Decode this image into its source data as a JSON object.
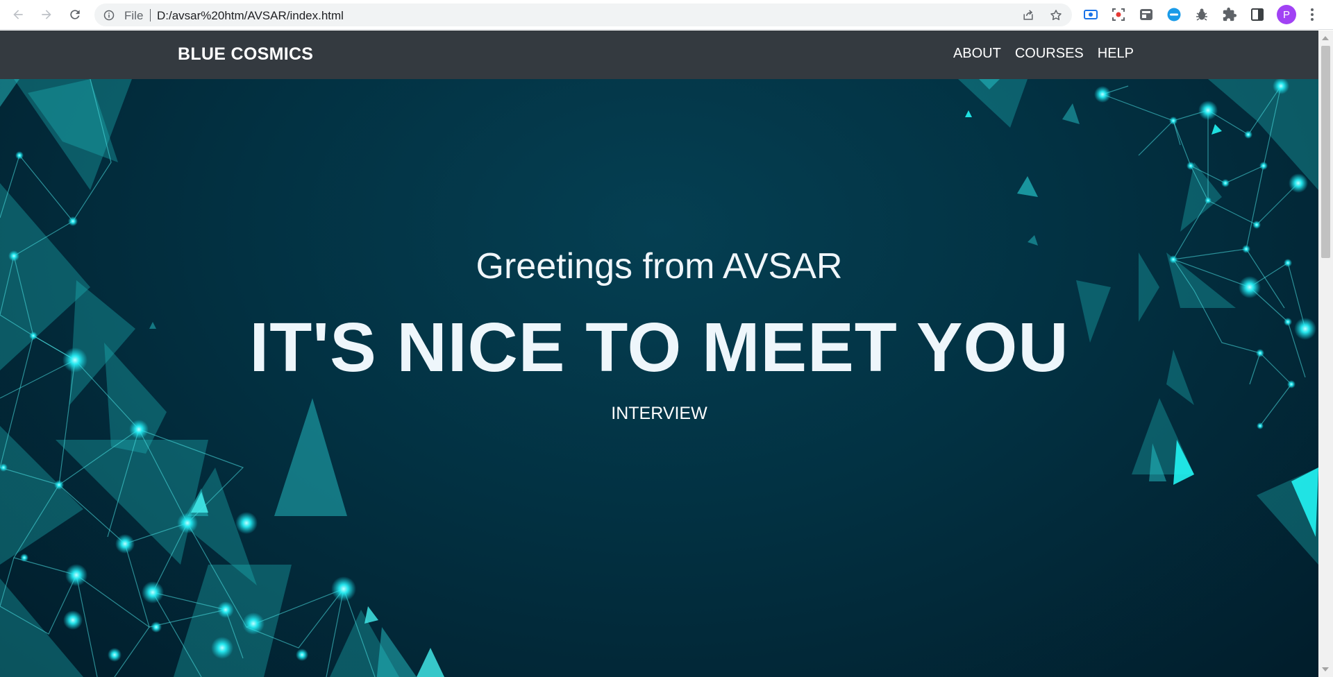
{
  "browser": {
    "scheme_label": "File",
    "url": "D:/avsar%20htm/AVSAR/index.html",
    "profile_initial": "P",
    "icons": [
      "back-icon",
      "forward-icon",
      "reload-icon",
      "info-icon",
      "share-icon",
      "bookmark-star-icon",
      "screen-capture-icon",
      "screen-record-icon",
      "extension-icon",
      "extension-icon",
      "bug-icon",
      "puzzle-icon",
      "side-panel-icon",
      "kebab-menu-icon"
    ]
  },
  "navbar": {
    "brand": "BLUE COSMICS",
    "links": [
      {
        "label": "ABOUT"
      },
      {
        "label": "COURSES"
      },
      {
        "label": "HELP"
      }
    ]
  },
  "hero": {
    "subtitle": "Greetings from AVSAR",
    "title": "IT'S NICE TO MEET YOU",
    "cta": "INTERVIEW"
  },
  "colors": {
    "navbar_bg": "#343a40",
    "hero_bg": "#023142",
    "accent_cyan": "#22e8f0",
    "profile": "#a142f4"
  }
}
